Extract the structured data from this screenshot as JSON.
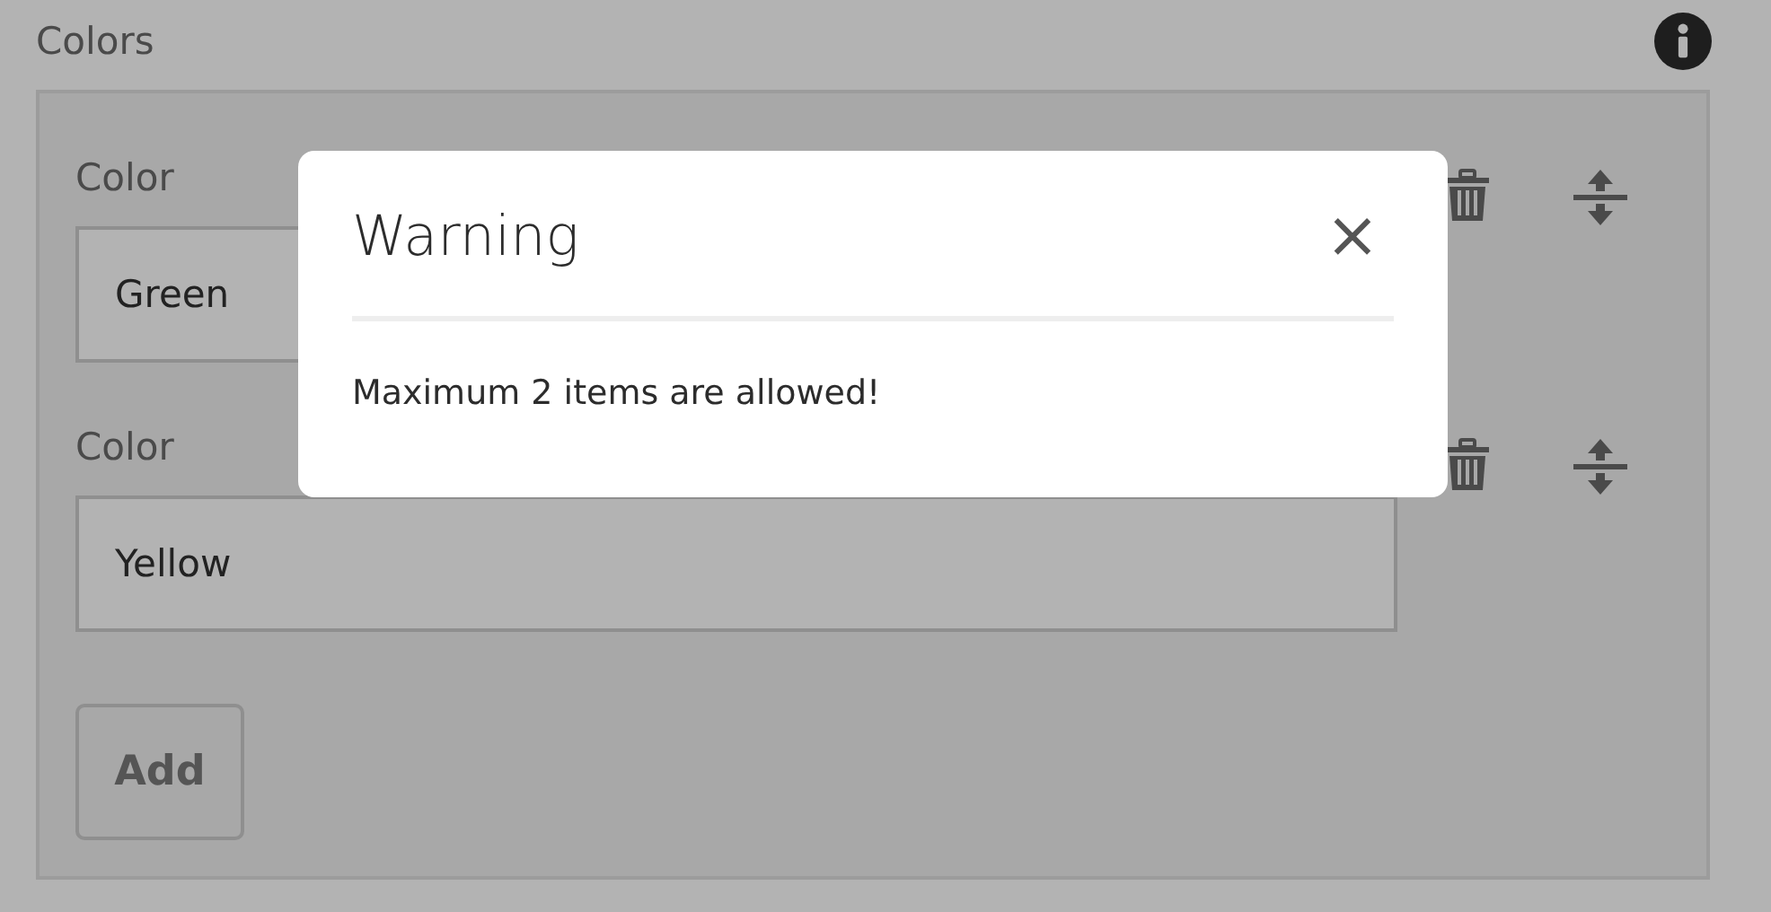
{
  "section": {
    "title": "Colors"
  },
  "items": [
    {
      "label": "Color",
      "value": "Green"
    },
    {
      "label": "Color",
      "value": "Yellow"
    }
  ],
  "add_button": "Add",
  "dialog": {
    "title": "Warning",
    "close": "×",
    "message": "Maximum 2 items are allowed!"
  }
}
